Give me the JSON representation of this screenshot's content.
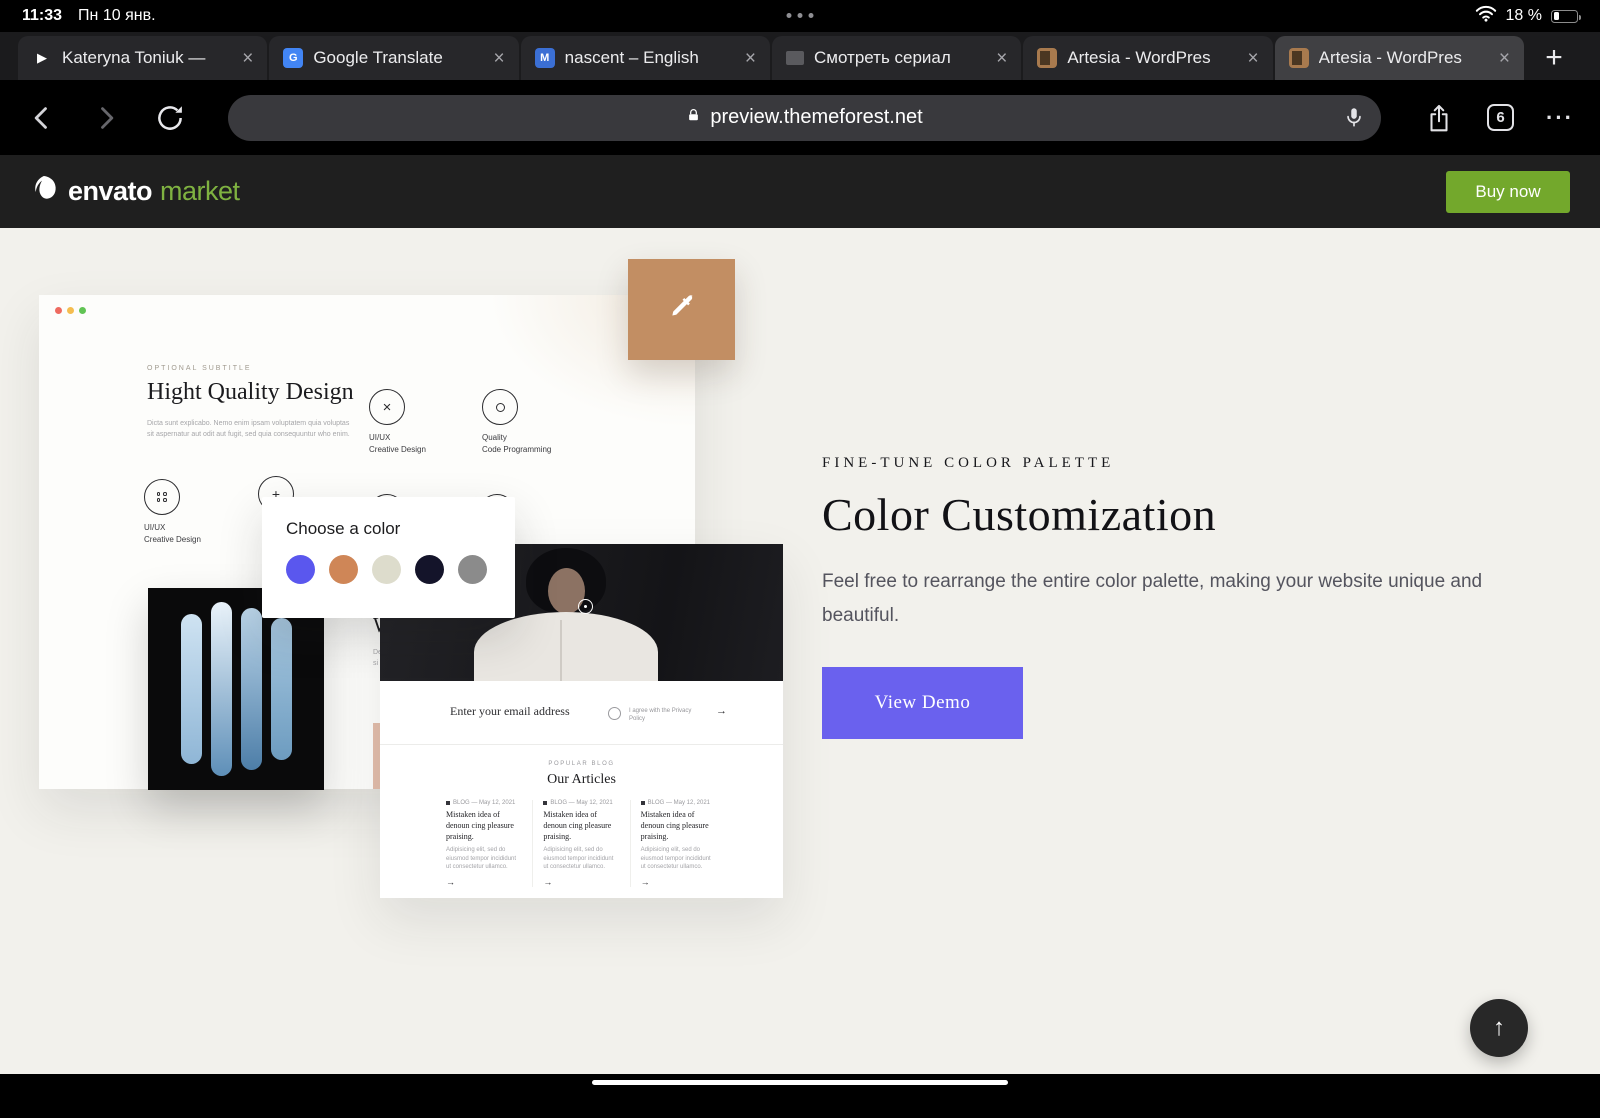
{
  "glyphs": {
    "close": "×",
    "new_tab": "+",
    "ellipsis": "···",
    "arrow_right": "→",
    "arrow_up": "↑",
    "play": "▶",
    "translate_letter": "G",
    "dict_letter": "M"
  },
  "status_bar": {
    "time": "11:33",
    "date": "Пн 10 янв.",
    "battery_percent": "18 %"
  },
  "tab_bar": {
    "tabs": [
      {
        "label": "Kateryna Toniuk —"
      },
      {
        "label": "Google Translate"
      },
      {
        "label": "nascent – English"
      },
      {
        "label": "Смотреть сериал"
      },
      {
        "label": "Artesia - WordPres"
      },
      {
        "label": "Artesia - WordPres"
      }
    ]
  },
  "address_bar": {
    "url": "preview.themeforest.net",
    "tab_count": "6"
  },
  "envato": {
    "brand": "envato",
    "brand_suffix": "market",
    "buy_now": "Buy now"
  },
  "section": {
    "eyebrow": "FINE-TUNE COLOR PALETTE",
    "title": "Color Customization",
    "description": "Feel free to rearrange the entire color palette, making your website unique and beautiful.",
    "cta": "View Demo"
  },
  "preview_card": {
    "subtitle": "OPTIONAL SUBTITLE",
    "heading": "Hight Quality Design",
    "body": "Dicta sunt explicabo. Nemo enim ipsam voluptatem quia voluptas sit aspernatur aut odit aut fugit, sed quia consequuntur who enim.",
    "features": [
      {
        "line1": "UI/UX",
        "line2": "Creative Design"
      },
      {
        "line1": "Quality",
        "line2": "Code Programming"
      },
      {
        "line1": "UI/UX",
        "line2": "Creative Design"
      },
      {
        "line1": "Quality",
        "line2": "Code Programming"
      }
    ],
    "covered_heading_fragment": "W",
    "covered_text_line1": "De",
    "covered_text_line2": "si"
  },
  "color_popup": {
    "title": "Choose a color",
    "swatches": [
      "#5a57ee",
      "#cf8657",
      "#dddccc",
      "#14142a",
      "#8b8b8b"
    ]
  },
  "demo_page": {
    "newsletter_label": "Enter your email address",
    "newsletter_note": "I agree with the Privacy Policy",
    "articles_eyebrow": "POPULAR BLOG",
    "articles_title": "Our Articles",
    "articles": [
      {
        "meta": "BLOG — May 12, 2021",
        "title": "Mistaken idea of denoun cing pleasure praising.",
        "excerpt": "Adipisicing elit, sed do eiusmod tempor incididunt ut consectetur ullamco."
      },
      {
        "meta": "BLOG — May 12, 2021",
        "title": "Mistaken idea of denoun cing pleasure praising.",
        "excerpt": "Adipisicing elit, sed do eiusmod tempor incididunt ut consectetur ullamco."
      },
      {
        "meta": "BLOG — May 12, 2021",
        "title": "Mistaken idea of denoun cing pleasure praising.",
        "excerpt": "Adipisicing elit, sed do eiusmod tempor incididunt ut consectetur ullamco."
      }
    ]
  },
  "colors": {
    "accent_indigo": "#6a61ee",
    "envato_green": "#7fb241",
    "buy_now_green": "#73a82c",
    "dropper_tile": "#c28e63",
    "mac_dot_red": "#ee6a5f",
    "mac_dot_yellow": "#f5bd4f",
    "mac_dot_green": "#61c454"
  }
}
